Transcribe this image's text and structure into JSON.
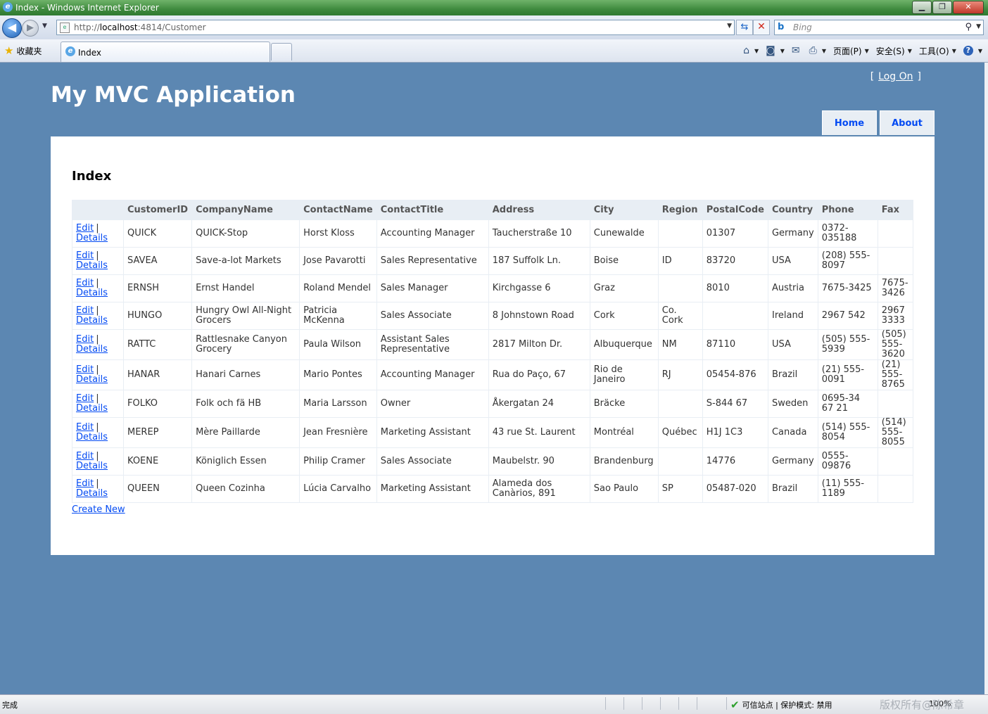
{
  "window": {
    "title": "Index - Windows Internet Explorer",
    "minimize": "▁",
    "maximize": "❐",
    "close": "✕"
  },
  "addressbar": {
    "url_prefix": "http://",
    "url_host": "localhost",
    "url_rest": ":4814/Customer",
    "search_placeholder": "Bing",
    "search_engine_glyph": "b"
  },
  "tabs": {
    "favorites_label": "收藏夹",
    "active_tab_label": "Index"
  },
  "commands": {
    "page": "页面(P)",
    "safety": "安全(S)",
    "tools": "工具(O)",
    "help": "?"
  },
  "header": {
    "login_open": "[",
    "login_label": "Log On",
    "login_close": "]",
    "app_title": "My MVC Application",
    "menu": [
      {
        "label": "Home"
      },
      {
        "label": "About"
      }
    ]
  },
  "main": {
    "heading": "Index",
    "columns": [
      "",
      "CustomerID",
      "CompanyName",
      "ContactName",
      "ContactTitle",
      "Address",
      "City",
      "Region",
      "PostalCode",
      "Country",
      "Phone",
      "Fax"
    ],
    "edit_label": "Edit",
    "details_label": "Details",
    "separator": "|",
    "rows": [
      [
        "QUICK",
        "QUICK-Stop",
        "Horst Kloss",
        "Accounting Manager",
        "Taucherstraße 10",
        "Cunewalde",
        "",
        "01307",
        "Germany",
        "0372-035188",
        ""
      ],
      [
        "SAVEA",
        "Save-a-lot Markets",
        "Jose Pavarotti",
        "Sales Representative",
        "187 Suffolk Ln.",
        "Boise",
        "ID",
        "83720",
        "USA",
        "(208) 555-8097",
        ""
      ],
      [
        "ERNSH",
        "Ernst Handel",
        "Roland Mendel",
        "Sales Manager",
        "Kirchgasse 6",
        "Graz",
        "",
        "8010",
        "Austria",
        "7675-3425",
        "7675-3426"
      ],
      [
        "HUNGO",
        "Hungry Owl All-Night Grocers",
        "Patricia McKenna",
        "Sales Associate",
        "8 Johnstown Road",
        "Cork",
        "Co. Cork",
        "",
        "Ireland",
        "2967 542",
        "2967 3333"
      ],
      [
        "RATTC",
        "Rattlesnake Canyon Grocery",
        "Paula Wilson",
        "Assistant Sales Representative",
        "2817 Milton Dr.",
        "Albuquerque",
        "NM",
        "87110",
        "USA",
        "(505) 555-5939",
        "(505) 555-3620"
      ],
      [
        "HANAR",
        "Hanari Carnes",
        "Mario Pontes",
        "Accounting Manager",
        "Rua do Paço, 67",
        "Rio de Janeiro",
        "RJ",
        "05454-876",
        "Brazil",
        "(21) 555-0091",
        "(21) 555-8765"
      ],
      [
        "FOLKO",
        "Folk och fä HB",
        "Maria Larsson",
        "Owner",
        "Åkergatan 24",
        "Bräcke",
        "",
        "S-844 67",
        "Sweden",
        "0695-34 67 21",
        ""
      ],
      [
        "MEREP",
        "Mère Paillarde",
        "Jean Fresnière",
        "Marketing Assistant",
        "43 rue St. Laurent",
        "Montréal",
        "Québec",
        "H1J 1C3",
        "Canada",
        "(514) 555-8054",
        "(514) 555-8055"
      ],
      [
        "KOENE",
        "Königlich Essen",
        "Philip Cramer",
        "Sales Associate",
        "Maubelstr. 90",
        "Brandenburg",
        "",
        "14776",
        "Germany",
        "0555-09876",
        ""
      ],
      [
        "QUEEN",
        "Queen Cozinha",
        "Lúcia Carvalho",
        "Marketing Assistant",
        "Alameda dos Canàrios, 891",
        "Sao Paulo",
        "SP",
        "05487-020",
        "Brazil",
        "(11) 555-1189",
        ""
      ]
    ],
    "create_new_label": "Create New"
  },
  "statusbar": {
    "status": "完成",
    "zone": "可信站点 | 保护模式: 禁用",
    "zoom": "100%",
    "watermark": "版权所有@陈希章"
  },
  "colors": {
    "page_background": "#5c87b2",
    "link": "#034af3",
    "table_header": "#e8eef4"
  }
}
